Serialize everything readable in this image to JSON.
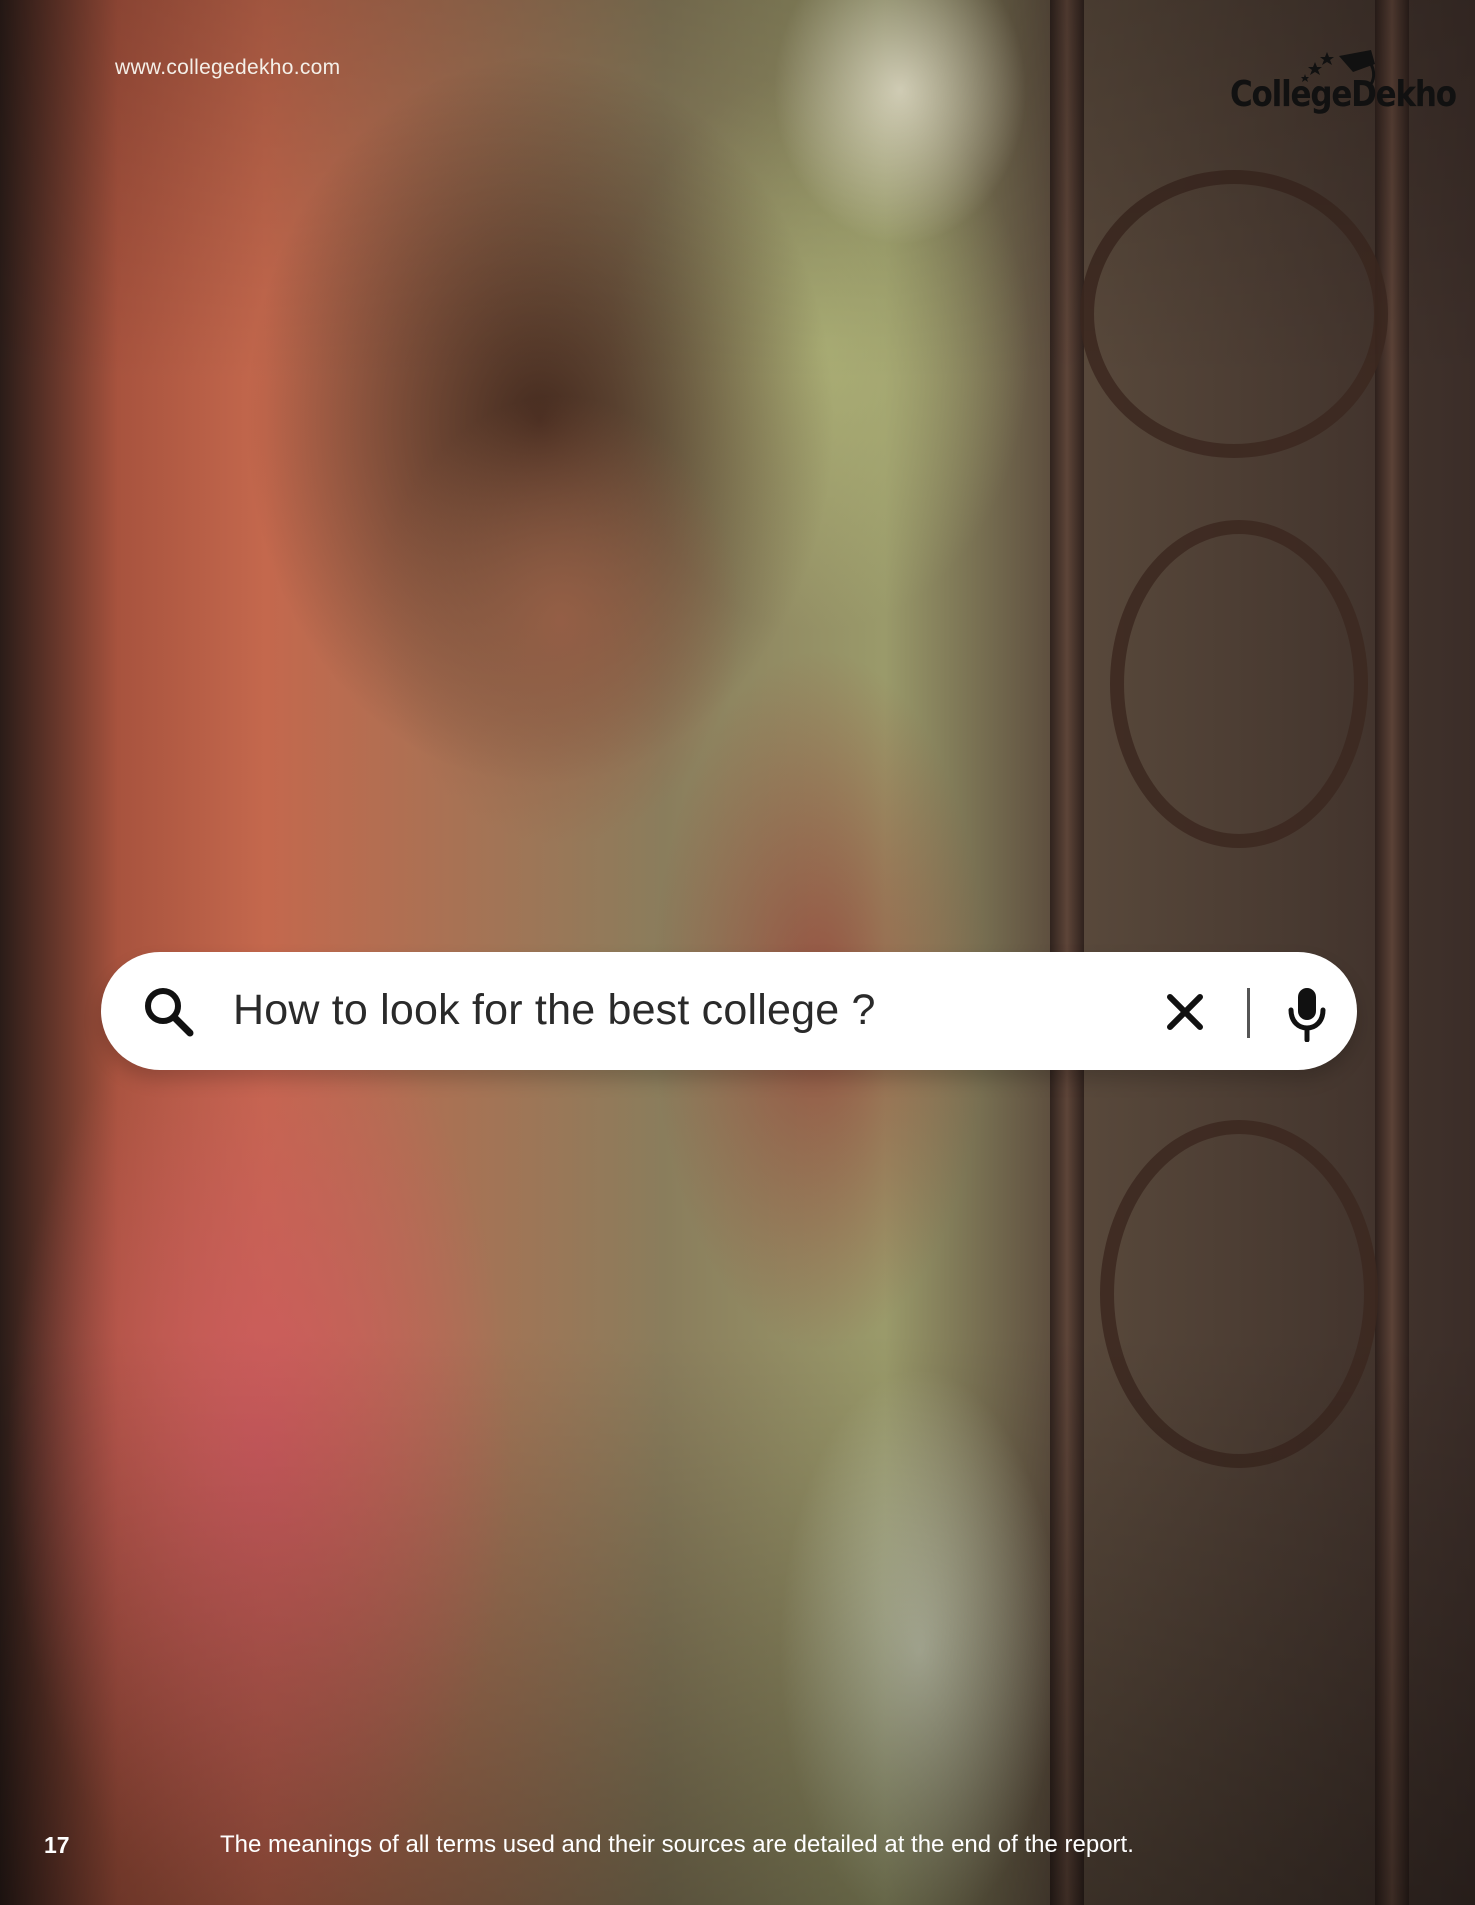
{
  "header": {
    "url": "www.collegedekho.com",
    "logo_text": "CollegeDekho"
  },
  "search": {
    "query": "How to look for the best college ?",
    "icons": [
      "search-icon",
      "close-icon",
      "microphone-icon"
    ]
  },
  "footer": {
    "page_number": "17",
    "note": "The meanings of all terms used and their sources are detailed at the end of the report."
  }
}
